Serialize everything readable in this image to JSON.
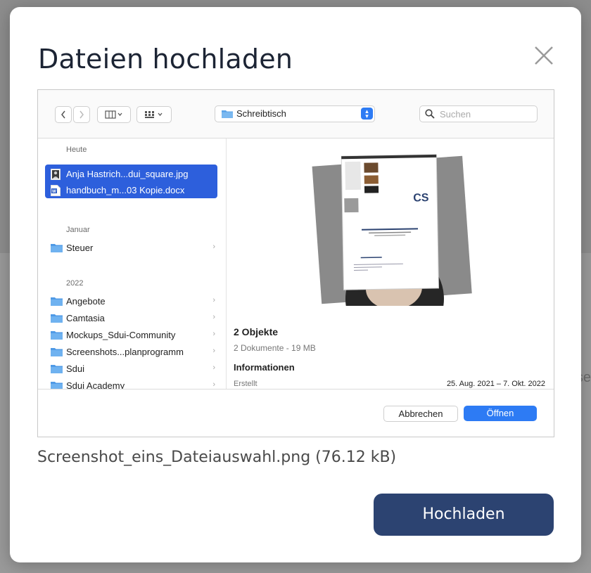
{
  "backdrop": {
    "partial_text": "se"
  },
  "modal": {
    "title": "Dateien hochladen",
    "close_icon": "close-icon"
  },
  "picker": {
    "location": "Schreibtisch",
    "search_placeholder": "Suchen",
    "sections": {
      "today": "Heute",
      "january": "Januar",
      "year": "2022"
    },
    "today_items": [
      {
        "label": "Anja Hastrich...dui_square.jpg",
        "icon": "image-file-icon"
      },
      {
        "label": "handbuch_m...03 Kopie.docx",
        "icon": "word-file-icon"
      }
    ],
    "january_items": [
      {
        "label": "Steuer",
        "icon": "folder-icon"
      }
    ],
    "year_items": [
      {
        "label": "Angebote",
        "icon": "folder-icon"
      },
      {
        "label": "Camtasia",
        "icon": "folder-icon"
      },
      {
        "label": "Mockups_Sdui-Community",
        "icon": "folder-icon"
      },
      {
        "label": "Screenshots...planprogramm",
        "icon": "folder-icon"
      },
      {
        "label": "Sdui",
        "icon": "folder-icon"
      },
      {
        "label": "Sdui Academy",
        "icon": "folder-icon"
      }
    ],
    "preview": {
      "objects_title": "2 Objekte",
      "objects_sub": "2 Dokumente - 19 MB",
      "info_title": "Informationen",
      "created_label": "Erstellt",
      "created_value": "25. Aug. 2021 – 7. Okt. 2022"
    },
    "cancel_label": "Abbrechen",
    "open_label": "Öffnen"
  },
  "file_caption": "Screenshot_eins_Dateiauswahl.png (76.12 kB)",
  "upload_label": "Hochladen",
  "colors": {
    "primary_button": "#2c4371",
    "mac_blue": "#2d7bf4",
    "selection_blue": "#2d5fdc"
  }
}
